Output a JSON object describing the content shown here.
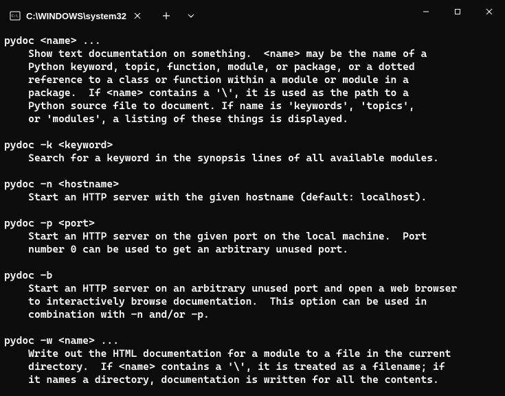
{
  "window": {
    "tab_title": "C:\\WINDOWS\\system32"
  },
  "terminal": {
    "content": "pydoc <name> ...\n    Show text documentation on something.  <name> may be the name of a\n    Python keyword, topic, function, module, or package, or a dotted\n    reference to a class or function within a module or module in a\n    package.  If <name> contains a '\\', it is used as the path to a\n    Python source file to document. If name is 'keywords', 'topics',\n    or 'modules', a listing of these things is displayed.\n\npydoc -k <keyword>\n    Search for a keyword in the synopsis lines of all available modules.\n\npydoc -n <hostname>\n    Start an HTTP server with the given hostname (default: localhost).\n\npydoc -p <port>\n    Start an HTTP server on the given port on the local machine.  Port\n    number 0 can be used to get an arbitrary unused port.\n\npydoc -b\n    Start an HTTP server on an arbitrary unused port and open a web browser\n    to interactively browse documentation.  This option can be used in\n    combination with -n and/or -p.\n\npydoc -w <name> ...\n    Write out the HTML documentation for a module to a file in the current\n    directory.  If <name> contains a '\\', it is treated as a filename; if\n    it names a directory, documentation is written for all the contents."
  }
}
